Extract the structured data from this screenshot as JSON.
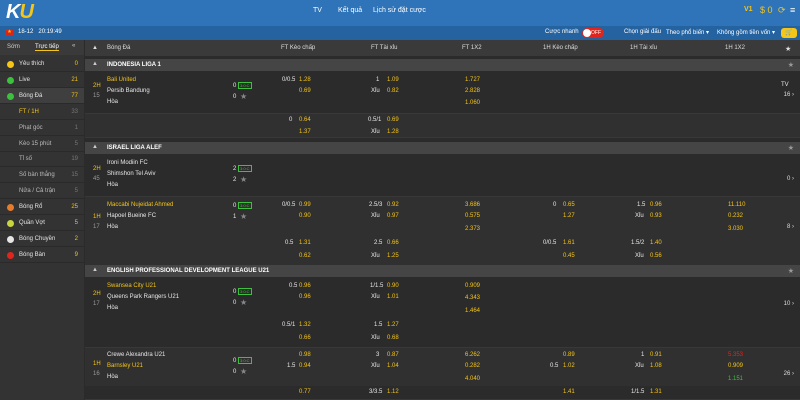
{
  "topbar": {
    "logo_k": "K",
    "logo_u": "U",
    "nav": [
      "TV",
      "Kết quả",
      "Lịch sử đặt cược"
    ],
    "vip": "V1",
    "balance": "$ 0"
  },
  "subbar": {
    "date": "18-12",
    "time": "20:19:49",
    "quick_bet": "Cược nhanh",
    "toggle": "OFF",
    "choose_league": "Chọn giải đấu",
    "sort": "Theo phổ biến",
    "stake": "Không gồm tiền vốn"
  },
  "sidebar": {
    "tabs": [
      "Sớm",
      "Trực tiếp"
    ],
    "rows": [
      {
        "label": "Yêu thích",
        "count": "0",
        "color": "#f5c518",
        "sub": false
      },
      {
        "label": "Live",
        "count": "21",
        "color": "#3fbf3f",
        "sub": false
      },
      {
        "label": "Bóng Đá",
        "count": "77",
        "color": "#3fbf3f",
        "sub": false
      },
      {
        "label": "FT / 1H",
        "count": "33",
        "color": "",
        "sub": true
      },
      {
        "label": "Phạt góc",
        "count": "1",
        "color": "",
        "sub": true
      },
      {
        "label": "Kèo 15 phút",
        "count": "5",
        "color": "",
        "sub": true
      },
      {
        "label": "Tỉ số",
        "count": "19",
        "color": "",
        "sub": true
      },
      {
        "label": "Số bàn thắng",
        "count": "15",
        "color": "",
        "sub": true
      },
      {
        "label": "Nửa / Cả trận",
        "count": "5",
        "color": "",
        "sub": true
      },
      {
        "label": "Bóng Rổ",
        "count": "25",
        "color": "#e87b2a",
        "sub": false
      },
      {
        "label": "Quần Vợt",
        "count": "5",
        "color": "#c7d63a",
        "sub": false
      },
      {
        "label": "Bóng Chuyền",
        "count": "2",
        "color": "#e6e6e6",
        "sub": false
      },
      {
        "label": "Bóng Bàn",
        "count": "9",
        "color": "#e2241c",
        "sub": false
      }
    ]
  },
  "header": {
    "sport": "Bóng Đá",
    "cols": [
      "FT Kèo chấp",
      "FT Tài xỉu",
      "FT 1X2",
      "1H Kèo chấp",
      "1H Tài xỉu",
      "1H 1X2"
    ]
  },
  "leagues": [
    {
      "name": "INDONESIA LIGA 1"
    },
    {
      "name": "ISRAEL LIGA ALEF"
    },
    {
      "name": "ENGLISH PROFESSIONAL DEVELOPMENT LEAGUE U21"
    }
  ],
  "matches": {
    "m1": {
      "period": "2H",
      "minute": "15",
      "home": "Bali United",
      "away": "Persib Bandung",
      "draw": "Hòa",
      "score_h": "0",
      "score_a": "0",
      "hcap_line": "0/0.5",
      "hcap_h": "1.28",
      "hcap_a": "0.69",
      "ou_line": "1",
      "ou_h": "1.09",
      "ou_x": "Xỉu",
      "ou_a": "0.82",
      "x_h": "1.727",
      "x_a": "2.828",
      "x_d": "1.060",
      "tv": "TV",
      "more": "16"
    },
    "m1b": {
      "hcap_line": "0",
      "hcap_h": "0.64",
      "hcap_a": "1.37",
      "ou_line": "0.5/1",
      "ou_h": "0.69",
      "ou_x": "Xỉu",
      "ou_a": "1.28"
    },
    "m2": {
      "period": "2H",
      "minute": "45",
      "home": "Ironi Modiin FC",
      "away": "Shimshon Tel Aviv",
      "draw": "Hòa",
      "score_h": "2",
      "score_a": "2",
      "more": "0"
    },
    "m3": {
      "period": "1H",
      "minute": "17",
      "home": "Maccabi Nujeidat Ahmed",
      "away": "Hapoel Bueine FC",
      "draw": "Hòa",
      "score_h": "0",
      "score_a": "1",
      "hcap_line": "0/0.5",
      "hcap_h": "0.99",
      "hcap_a": "0.90",
      "ou_line": "2.5/3",
      "ou_h": "0.92",
      "ou_x": "Xỉu",
      "ou_a": "0.97",
      "x_h": "3.686",
      "x_a": "0.575",
      "x_d": "2.373",
      "h1_line": "0",
      "h1_h": "0.65",
      "h1_a": "1.27",
      "h1ou_line": "1.5",
      "h1ou_h": "0.96",
      "h1ou_x": "Xỉu",
      "h1ou_a": "0.93",
      "h1x_h": "11.110",
      "h1x_a": "0.232",
      "h1x_d": "3.030",
      "more": "8"
    },
    "m3b": {
      "hcap_line": "0.5",
      "hcap_h": "1.31",
      "hcap_a": "0.62",
      "ou_line": "2.5",
      "ou_h": "0.66",
      "ou_x": "Xỉu",
      "ou_a": "1.25",
      "h1_line": "0/0.5",
      "h1_h": "1.61",
      "h1_a": "0.45",
      "h1ou_line": "1.5/2",
      "h1ou_h": "1.40",
      "h1ou_x": "Xỉu",
      "h1ou_a": "0.56"
    },
    "m4": {
      "period": "2H",
      "minute": "17",
      "home": "Swansea City U21",
      "away": "Queens Park Rangers U21",
      "draw": "Hòa",
      "score_h": "0",
      "score_a": "0",
      "hcap_line": "0.5",
      "hcap_h": "0.96",
      "hcap_a": "0.96",
      "ou_line": "1/1.5",
      "ou_h": "0.90",
      "ou_x": "Xỉu",
      "ou_a": "1.01",
      "x_h": "0.909",
      "x_a": "4.343",
      "x_d": "1.464",
      "more": "10"
    },
    "m4b": {
      "hcap_line": "0.5/1",
      "hcap_h": "1.32",
      "hcap_a": "0.66",
      "ou_line": "1.5",
      "ou_h": "1.27",
      "ou_x": "Xỉu",
      "ou_a": "0.68"
    },
    "m5": {
      "period": "1H",
      "minute": "16",
      "home": "Crewe Alexandra U21",
      "away": "Barnsley U21",
      "draw": "Hòa",
      "score_h": "0",
      "score_a": "0",
      "hcap_line": "",
      "hcap_h": "0.98",
      "hcap_line2": "1.5",
      "hcap_a": "0.94",
      "ou_line": "3",
      "ou_h": "0.87",
      "ou_x": "Xỉu",
      "ou_a": "1.04",
      "x_h": "6.262",
      "x_a": "0.282",
      "x_d": "4.040",
      "h1_line": "0.5",
      "h1_h": "0.89",
      "h1_a": "1.02",
      "h1ou_line": "1",
      "h1ou_h": "0.91",
      "h1ou_x": "Xỉu",
      "h1ou_a": "1.08",
      "h1x_h": "5.353",
      "h1x_a": "0.909",
      "h1x_d": "1.151",
      "more": "26"
    },
    "m5b": {
      "hcap_h": "0.77",
      "ou_line": "3/3.5",
      "ou_h": "1.12",
      "h1_h": "1.41",
      "h1ou_line": "1/1.5",
      "h1ou_h": "1.31"
    }
  }
}
